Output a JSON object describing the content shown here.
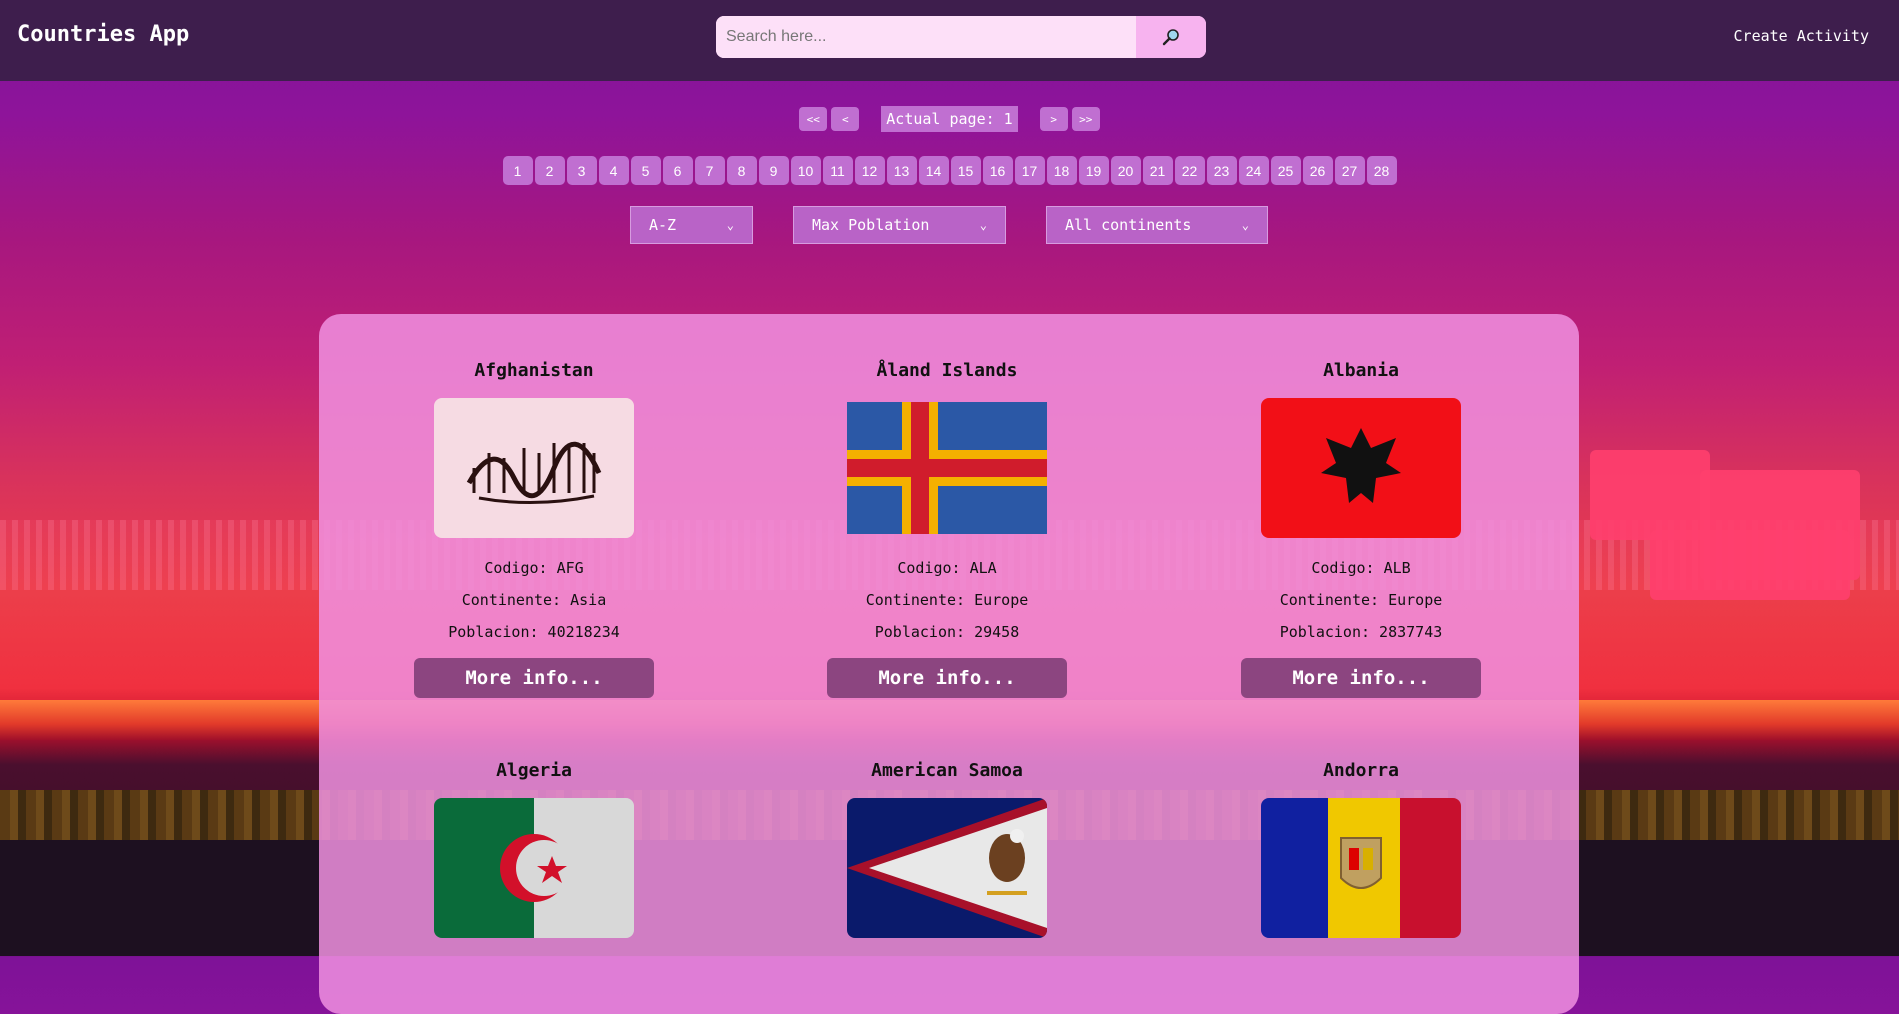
{
  "navbar": {
    "brand": "Countries App",
    "search_placeholder": "Search here...",
    "search_icon": "search-icon",
    "create_activity": "Create Activity"
  },
  "pagination": {
    "first": "<<",
    "prev": "<",
    "actual": "Actual page: 1",
    "next": ">",
    "last": ">>",
    "pages": [
      "1",
      "2",
      "3",
      "4",
      "5",
      "6",
      "7",
      "8",
      "9",
      "10",
      "11",
      "12",
      "13",
      "14",
      "15",
      "16",
      "17",
      "18",
      "19",
      "20",
      "21",
      "22",
      "23",
      "24",
      "25",
      "26",
      "27",
      "28"
    ]
  },
  "filters": {
    "order": "A-Z",
    "population": "Max Poblation",
    "continent": "All continents"
  },
  "cards": [
    {
      "name": "Afghanistan",
      "code": "Codigo: AFG",
      "continent": "Continente: Asia",
      "population": "Poblacion: 40218234",
      "more": "More info..."
    },
    {
      "name": "Åland Islands",
      "code": "Codigo: ALA",
      "continent": "Continente: Europe",
      "population": "Poblacion: 29458",
      "more": "More info..."
    },
    {
      "name": "Albania",
      "code": "Codigo: ALB",
      "continent": "Continente: Europe",
      "population": "Poblacion: 2837743",
      "more": "More info..."
    },
    {
      "name": "Algeria"
    },
    {
      "name": "American Samoa"
    },
    {
      "name": "Andorra"
    }
  ]
}
